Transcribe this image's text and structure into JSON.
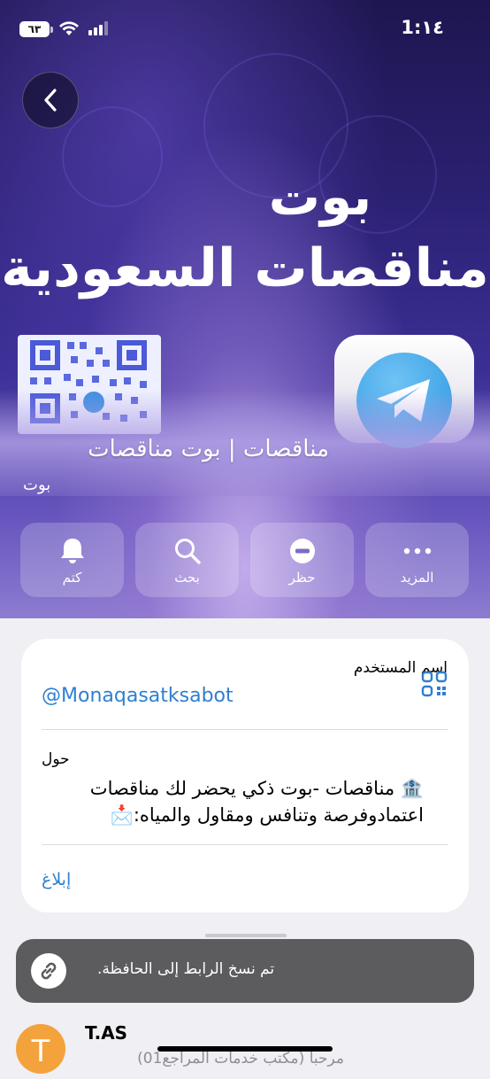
{
  "status_bar": {
    "time": "1:١٤",
    "battery": "٦٣"
  },
  "hero": {
    "poster_title_line1": "بوت",
    "poster_title_line2": "مناقصات السعودية",
    "profile_name": "مناقصات | بوت مناقصات",
    "profile_subtitle": "بوت"
  },
  "actions": [
    {
      "label": "المزيد",
      "icon": "more-icon"
    },
    {
      "label": "حظر",
      "icon": "block-icon"
    },
    {
      "label": "بحث",
      "icon": "search-icon"
    },
    {
      "label": "كتم",
      "icon": "bell-icon"
    }
  ],
  "info": {
    "username_label": "اسم المستخدم",
    "username": "@Monaqasatksabot",
    "about_label": "حول",
    "about_text": "🏦 مناقصات -بوت ذكي يحضر لك مناقصات اعتمادوفرصة وتنافس ومقاول والمياه:📩",
    "report_label": "إبلاغ"
  },
  "toast": {
    "text": "تم نسخ الرابط إلى الحافظة."
  },
  "chat_preview": {
    "avatar_letter": "T",
    "name": "T.AS",
    "preview": "مرحباً (مكتب خدمات المراجع01)"
  },
  "colors": {
    "link": "#2f7fd0",
    "avatar": "#f4a23b",
    "toast_bg": "#5c5c5e"
  }
}
